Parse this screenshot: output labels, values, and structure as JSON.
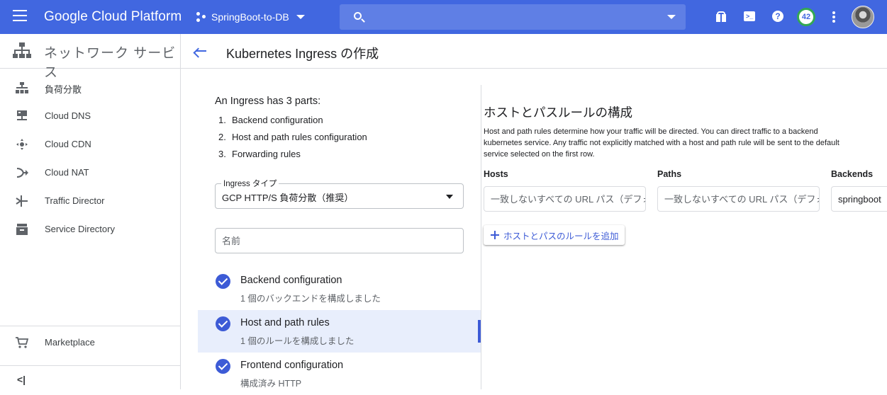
{
  "topbar": {
    "brand": "Google Cloud Platform",
    "project": "SpringBoot-to-DB",
    "notifications_count": "42"
  },
  "sidebar": {
    "title": "ネットワーク サービス",
    "items": [
      {
        "label": "負荷分散",
        "icon": "load-balancing-icon"
      },
      {
        "label": "Cloud DNS",
        "icon": "dns-icon"
      },
      {
        "label": "Cloud CDN",
        "icon": "cdn-icon"
      },
      {
        "label": "Cloud NAT",
        "icon": "nat-icon"
      },
      {
        "label": "Traffic Director",
        "icon": "traffic-director-icon"
      },
      {
        "label": "Service Directory",
        "icon": "service-directory-icon"
      }
    ],
    "marketplace": "Marketplace",
    "collapse_glyph": "<|"
  },
  "page": {
    "title": "Kubernetes Ingress の作成"
  },
  "intro": {
    "heading": "An Ingress has 3 parts:",
    "parts": [
      {
        "num": "1.",
        "text": "Backend configuration"
      },
      {
        "num": "2.",
        "text": "Host and path rules configuration"
      },
      {
        "num": "3.",
        "text": "Forwarding rules"
      }
    ]
  },
  "form": {
    "ingress_type_label": "Ingress タイプ",
    "ingress_type_value": "GCP HTTP/S 負荷分散（推奨）",
    "name_placeholder": "名前"
  },
  "steps": [
    {
      "title": "Backend configuration",
      "subtitle": "1 個のバックエンドを構成しました"
    },
    {
      "title": "Host and path rules",
      "subtitle": "1 個のルールを構成しました"
    },
    {
      "title": "Frontend configuration",
      "subtitle": "構成済み HTTP"
    }
  ],
  "rules": {
    "title": "ホストとパスルールの構成",
    "description": "Host and path rules determine how your traffic will be directed. You can direct traffic to a backend kubernetes service. Any traffic not explicitly matched with a host and path rule will be sent to the default service selected on the first row.",
    "headers": {
      "hosts": "Hosts",
      "paths": "Paths",
      "backends": "Backends"
    },
    "row": {
      "hosts_placeholder": "一致しないすべての URL パス（デフォルト）",
      "paths_placeholder": "一致しないすべての URL パス（デフォルト）",
      "backend_value": "springboot"
    },
    "add_button": "ホストとパスのルールを追加"
  },
  "colors": {
    "topbar": "#4167e0",
    "accent": "#3d5bd6",
    "active_step_bg": "#e8eefc"
  }
}
